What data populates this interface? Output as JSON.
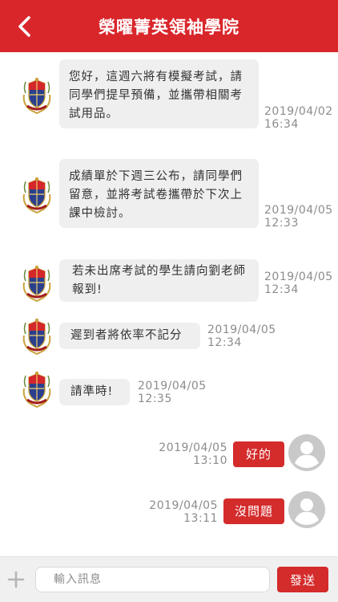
{
  "header": {
    "title": "榮曜菁英領袖學院"
  },
  "messages": [
    {
      "text": "您好，這週六將有模擬考試，請同學們提早預備，並攜帶相關考試用品。",
      "date": "2019/04/02",
      "time": "16:34"
    },
    {
      "text": "成績單於下週三公布，請同學們留意，並將考試卷攜帶於下次上課中檢討。",
      "date": "2019/04/05",
      "time": "12:33"
    },
    {
      "text": "若未出席考試的學生請向劉老師報到!",
      "date": "2019/04/05",
      "time": "12:34"
    },
    {
      "text": "遲到者將依率不記分",
      "date": "2019/04/05",
      "time": "12:34"
    },
    {
      "text": "請準時!",
      "date": "2019/04/05",
      "time": "12:35"
    }
  ],
  "replies": [
    {
      "text": "好的",
      "date": "2019/04/05",
      "time": "13:10"
    },
    {
      "text": "沒問題",
      "date": "2019/04/05",
      "time": "13:11"
    }
  ],
  "composer": {
    "placeholder": "輸入訊息",
    "send_label": "發送"
  },
  "colors": {
    "brand_red": "#d9262b",
    "bubble_gray": "#efefef",
    "timestamp_gray": "#8c8c8c"
  }
}
